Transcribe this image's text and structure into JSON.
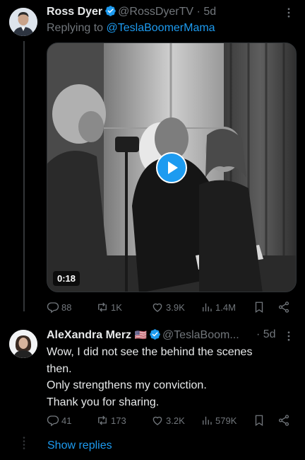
{
  "tweet1": {
    "author_name": "Ross Dyer",
    "author_handle": "@RossDyerTV",
    "separator": "·",
    "time": "5d",
    "replying_prefix": "Replying to ",
    "replying_handle": "@TeslaBoomerMama",
    "video_duration": "0:18",
    "stats": {
      "replies": "88",
      "reposts": "1K",
      "likes": "3.9K",
      "views": "1.4M"
    }
  },
  "tweet2": {
    "author_name": "AleXandra Merz",
    "flag": "🇺🇸",
    "author_handle": "@TeslaBoom...",
    "separator": "·",
    "time": "5d",
    "text_lines": [
      "Wow, I did not see the behind the scenes",
      "then.",
      "Only strengthens my conviction.",
      "Thank you for sharing."
    ],
    "stats": {
      "replies": "41",
      "reposts": "173",
      "likes": "3.2K",
      "views": "579K"
    }
  },
  "show_replies_label": "Show replies",
  "colors": {
    "accent": "#1d9bf0",
    "muted": "#71767b",
    "text": "#e7e9ea",
    "background": "#000000"
  }
}
